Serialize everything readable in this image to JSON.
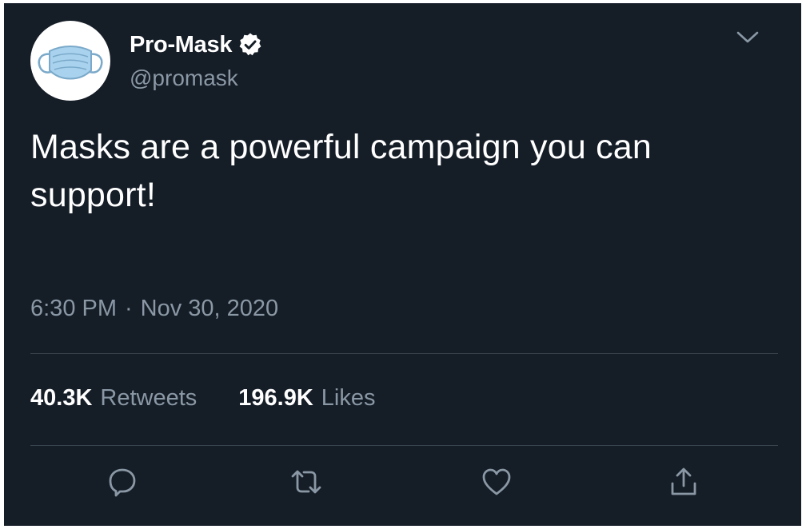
{
  "tweet": {
    "author": {
      "display_name": "Pro-Mask",
      "handle": "@promask",
      "verified": true,
      "avatar_icon": "face-mask-icon"
    },
    "text": "Masks are a powerful campaign you can support!",
    "time": "6:30 PM",
    "separator": "·",
    "date": "Nov 30, 2020",
    "stats": {
      "retweets_count": "40.3K",
      "retweets_label": "Retweets",
      "likes_count": "196.9K",
      "likes_label": "Likes"
    },
    "actions": [
      {
        "name": "reply",
        "icon": "reply-icon"
      },
      {
        "name": "retweet",
        "icon": "retweet-icon"
      },
      {
        "name": "like",
        "icon": "heart-icon"
      },
      {
        "name": "share",
        "icon": "share-icon"
      }
    ]
  },
  "colors": {
    "background": "#151d27",
    "primary_text": "#ffffff",
    "secondary_text": "#8a98a5",
    "divider": "#38444d",
    "mask_blue": "#a9d2ee"
  }
}
